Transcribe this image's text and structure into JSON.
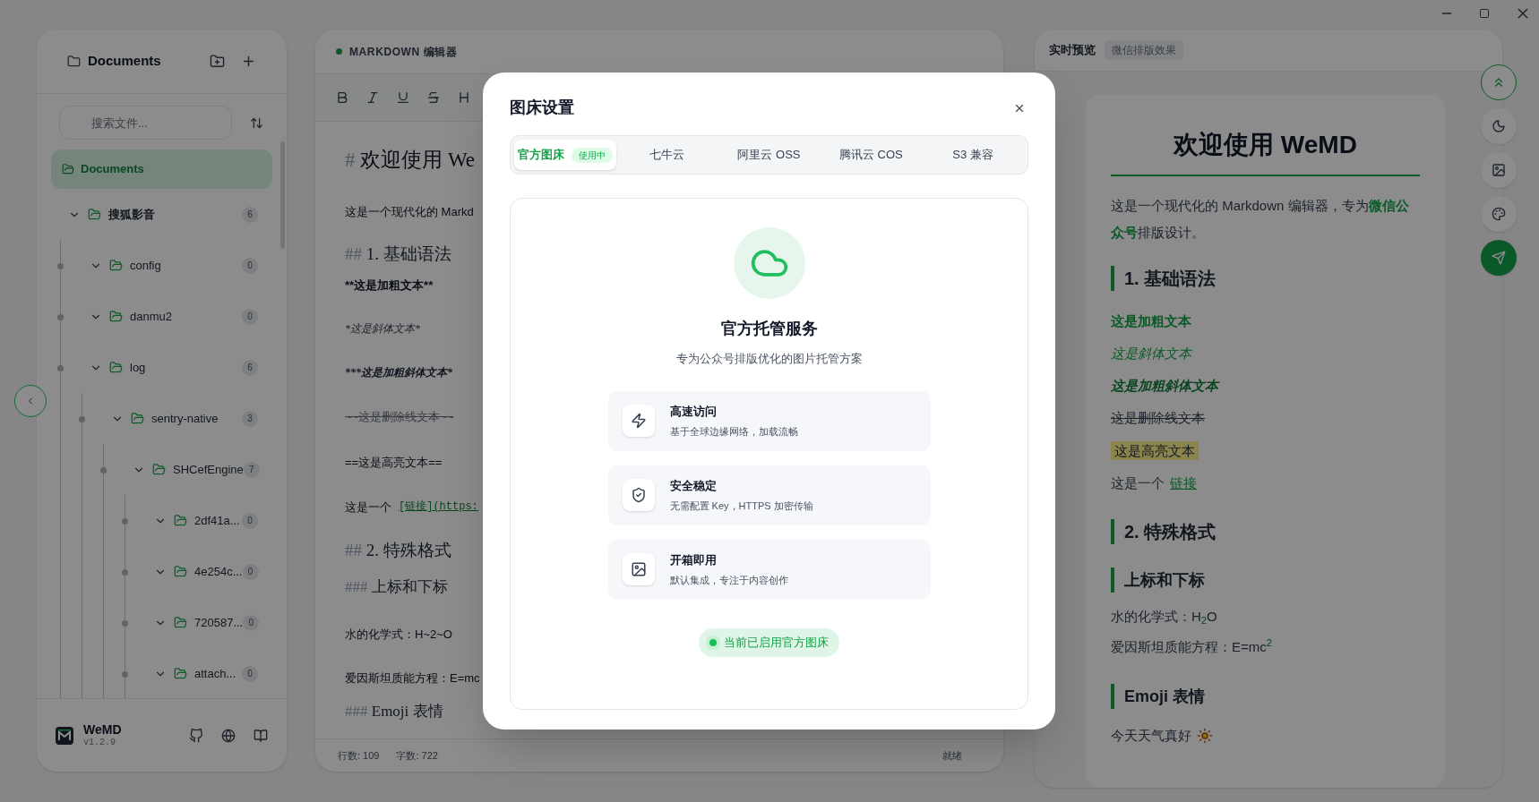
{
  "sidebar": {
    "title": "Documents",
    "search": {
      "placeholder": "搜索文件..."
    },
    "root": {
      "name": "Documents",
      "selected": true
    },
    "tree": [
      {
        "name": "搜狐影音",
        "count": "6",
        "expanded": true,
        "selected": false,
        "children": [
          {
            "name": "config",
            "count": "0",
            "expanded": true,
            "selected": false
          },
          {
            "name": "danmu2",
            "count": "0",
            "expanded": true,
            "selected": false
          },
          {
            "name": "log",
            "count": "6",
            "expanded": true,
            "selected": false,
            "children": [
              {
                "name": "sentry-native",
                "count": "3",
                "expanded": true,
                "selected": false,
                "children": [
                  {
                    "name": "SHCefEngine",
                    "count": "7",
                    "expanded": true,
                    "selected": false,
                    "children": [
                      {
                        "name": "2df41a...",
                        "count": "0",
                        "expanded": true,
                        "selected": false
                      },
                      {
                        "name": "4e254c...",
                        "count": "0",
                        "expanded": true,
                        "selected": false
                      },
                      {
                        "name": "720587...",
                        "count": "0",
                        "expanded": true,
                        "selected": false
                      },
                      {
                        "name": "attach...",
                        "count": "0",
                        "expanded": true,
                        "selected": false
                      }
                    ]
                  }
                ]
              }
            ]
          }
        ]
      }
    ],
    "footer": {
      "app_name": "WeMD",
      "version": "v1.2.9"
    }
  },
  "editor": {
    "title": "MARKDOWN 编辑器",
    "lines": [
      {
        "kind": "h1",
        "marker": "#",
        "text": "欢迎使用 We"
      },
      {
        "kind": "p",
        "text": "这是一个现代化的 Markd"
      },
      {
        "kind": "h2",
        "marker": "##",
        "text": "1. 基础语法"
      },
      {
        "kind": "bold",
        "text": "**这是加粗文本**"
      },
      {
        "kind": "italic",
        "text": "*这是斜体文本*"
      },
      {
        "kind": "bolditalic",
        "text": "***这是加粗斜体文本*"
      },
      {
        "kind": "strike",
        "text": "~~这是删除线文本~~"
      },
      {
        "kind": "highlight",
        "text": "==这是高亮文本=="
      },
      {
        "kind": "link",
        "text": "这是一个",
        "link": "[链接](https:"
      },
      {
        "kind": "h2",
        "marker": "##",
        "text": "2. 特殊格式"
      },
      {
        "kind": "h3",
        "marker": "###",
        "text": "上标和下标"
      },
      {
        "kind": "p",
        "text": "水的化学式：H~2~O"
      },
      {
        "kind": "p",
        "text": "爱因斯坦质能方程：E=mc"
      },
      {
        "kind": "h3",
        "marker": "###",
        "text": "Emoji 表情"
      }
    ],
    "status": {
      "lines": "行数: 109",
      "chars": "字数: 722",
      "state": "就绪"
    }
  },
  "preview": {
    "title": "实时预览",
    "badge": "微信排版效果",
    "content": [
      {
        "kind": "title",
        "text": "欢迎使用 WeMD"
      },
      {
        "kind": "para",
        "text": "这是一个现代化的 Markdown 编辑器，专为**微信公众号**排版设计。"
      },
      {
        "kind": "h2",
        "text": "1. 基础语法"
      },
      {
        "kind": "bold",
        "text": "这是加粗文本"
      },
      {
        "kind": "italic",
        "text": "这是斜体文本"
      },
      {
        "kind": "bolditalic",
        "text": "这是加粗斜体文本"
      },
      {
        "kind": "strike",
        "text": "这是删除线文本"
      },
      {
        "kind": "highlight",
        "text": "这是高亮文本"
      },
      {
        "kind": "link",
        "text": "这是一个",
        "link": "链接"
      },
      {
        "kind": "h2",
        "text": "2. 特殊格式"
      },
      {
        "kind": "h3",
        "text": "上标和下标"
      },
      {
        "kind": "para",
        "text": "水的化学式：H$_{2}$O"
      },
      {
        "kind": "para",
        "text": "爱因斯坦质能方程：E=mc$^{2}$"
      },
      {
        "kind": "h3",
        "text": "Emoji 表情"
      },
      {
        "kind": "emoji",
        "text": "今天天气真好"
      }
    ]
  },
  "dialog": {
    "title": "图床设置",
    "tabs": [
      {
        "label": "官方图床",
        "badge": "使用中",
        "selected": true
      },
      {
        "label": "七牛云",
        "selected": false
      },
      {
        "label": "阿里云 OSS",
        "selected": false
      },
      {
        "label": "腾讯云 COS",
        "selected": false
      },
      {
        "label": "S3 兼容",
        "selected": false
      }
    ],
    "service": {
      "title": "官方托管服务",
      "subtitle": "专为公众号排版优化的图片托管方案",
      "features": [
        {
          "kind": "speed",
          "title": "高速访问",
          "text": "基于全球边缘网络，加载流畅"
        },
        {
          "kind": "security",
          "title": "安全稳定",
          "text": "无需配置 Key，HTTPS 加密传输"
        },
        {
          "kind": "ready",
          "title": "开箱即用",
          "text": "默认集成，专注于内容创作"
        }
      ],
      "status": "当前已启用官方图床"
    }
  }
}
